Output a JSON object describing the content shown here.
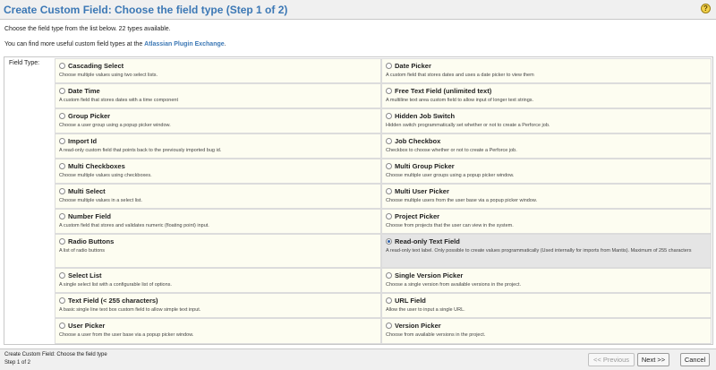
{
  "header": {
    "title": "Create Custom Field: Choose the field type (Step 1 of 2)",
    "help_icon": "help-icon",
    "help_glyph": "?"
  },
  "intro": {
    "text1": "Choose the field type from the list below. 22 types available.",
    "text2_prefix": "You can find more useful custom field types at the ",
    "text2_link": "Atlassian Plugin Exchange",
    "text2_suffix": "."
  },
  "form": {
    "label": "Field Type:",
    "selected": "Read-only Text Field",
    "options": [
      {
        "name": "Cascading Select",
        "description": "Choose multiple values using two select lists."
      },
      {
        "name": "Date Picker",
        "description": "A custom field that stores dates and uses a date picker to view them"
      },
      {
        "name": "Date Time",
        "description": "A custom field that stores dates with a time component"
      },
      {
        "name": "Free Text Field (unlimited text)",
        "description": "A multiline text area custom field to allow input of longer text strings."
      },
      {
        "name": "Group Picker",
        "description": "Choose a user group using a popup picker window."
      },
      {
        "name": "Hidden Job Switch",
        "description": "Hidden switch programmatically set whether or not to create a Perforce job."
      },
      {
        "name": "Import Id",
        "description": "A read-only custom field that points back to the previously imported bug id."
      },
      {
        "name": "Job Checkbox",
        "description": "Checkbox to choose whether or not to create a Perforce job."
      },
      {
        "name": "Multi Checkboxes",
        "description": "Choose multiple values using checkboxes."
      },
      {
        "name": "Multi Group Picker",
        "description": "Choose multiple user groups using a popup picker window."
      },
      {
        "name": "Multi Select",
        "description": "Choose multiple values in a select list."
      },
      {
        "name": "Multi User Picker",
        "description": "Choose multiple users from the user base via a popup picker window."
      },
      {
        "name": "Number Field",
        "description": "A custom field that stores and validates numeric (floating point) input."
      },
      {
        "name": "Project Picker",
        "description": "Choose from projects that the user can view in the system."
      },
      {
        "name": "Radio Buttons",
        "description": "A list of radio buttons"
      },
      {
        "name": "Read-only Text Field",
        "description": "A read-only text label. Only possible to create values programmatically (Used internally for imports from Mantis). Maximum of 255 characters"
      },
      {
        "name": "Select List",
        "description": "A single select list with a configurable list of options."
      },
      {
        "name": "Single Version Picker",
        "description": "Choose a single version from available versions in the project."
      },
      {
        "name": "Text Field (< 255 characters)",
        "description": "A basic single line text box custom field to allow simple text input."
      },
      {
        "name": "URL Field",
        "description": "Allow the user to input a single URL."
      },
      {
        "name": "User Picker",
        "description": "Choose a user from the user base via a popup picker window."
      },
      {
        "name": "Version Picker",
        "description": "Choose from available versions in the project."
      }
    ]
  },
  "footer": {
    "crumb_line1": "Create Custom Field: Choose the field type",
    "crumb_line2": "Step 1 of 2",
    "prev_label": "<< Previous",
    "next_label": "Next >>",
    "cancel_label": "Cancel"
  },
  "colors": {
    "title": "#3c78b5",
    "cell_background": "#fdfdf1",
    "selected_background": "#e5e5e5"
  }
}
